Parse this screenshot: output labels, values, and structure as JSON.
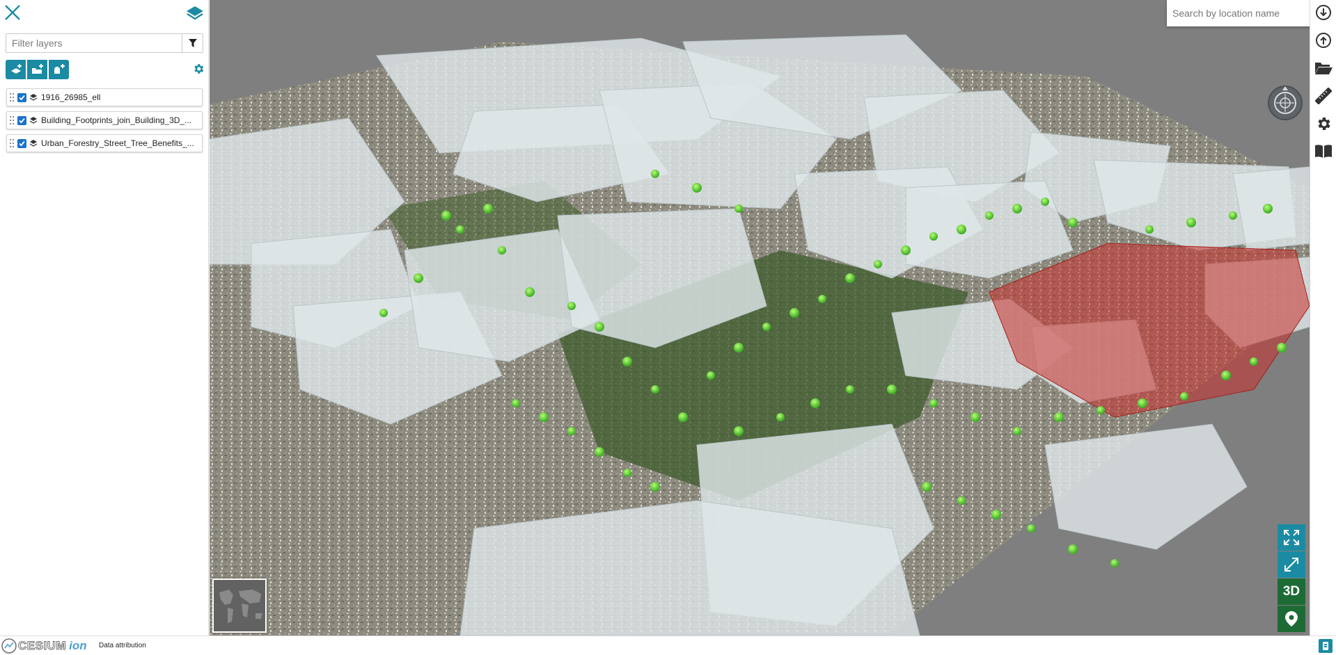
{
  "sidebar": {
    "filter_placeholder": "Filter layers",
    "layers": [
      {
        "name": "1916_26985_ell",
        "checked": true
      },
      {
        "name": "Building_Footprints_join_Building_3D_...",
        "checked": true
      },
      {
        "name": "Urban_Forestry_Street_Tree_Benefits_...",
        "checked": true
      }
    ]
  },
  "search": {
    "placeholder": "Search by location name"
  },
  "view_controls": {
    "mode_label": "3D"
  },
  "footer": {
    "logo_text": "CESIUM",
    "logo_ion": "ion",
    "attribution_label": "Data attribution"
  },
  "colors": {
    "accent": "#1b8ba3",
    "accent_dark": "#1d6b34",
    "map_background": "#7f7f7f",
    "checkbox": "#1a73c9"
  },
  "icons": {
    "close": "close-icon",
    "layers": "layers-icon",
    "filter": "filter-icon",
    "add_data": "add-data-icon",
    "add_folder": "add-folder-icon",
    "add_service": "add-service-icon",
    "settings": "gear-icon",
    "drag": "drag-handle-icon",
    "layer_type": "layer-stack-icon",
    "search": "search-icon",
    "menu": "menu-icon",
    "compass": "compass-icon",
    "expand": "fullscreen-expand-icon",
    "collapse": "fullscreen-collapse-icon",
    "location": "location-pin-icon",
    "download": "download-icon",
    "upload": "upload-icon",
    "open": "folder-open-icon",
    "measure": "ruler-icon",
    "help": "book-icon"
  }
}
